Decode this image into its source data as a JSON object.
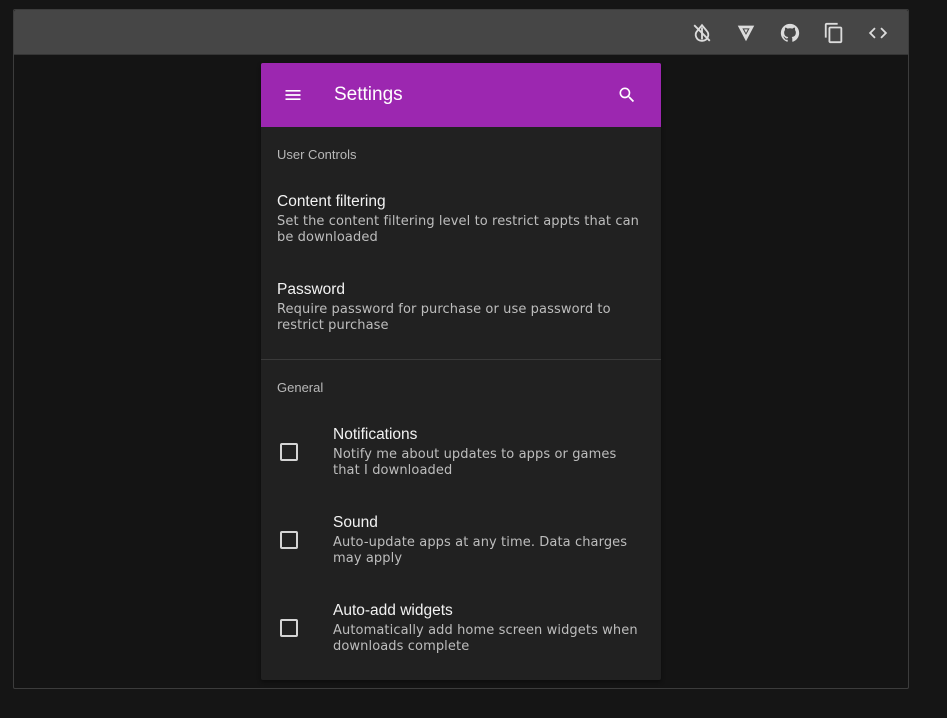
{
  "toolbar": {
    "icons": [
      "invert-colors-off-icon",
      "vuetify-logo-icon",
      "github-icon",
      "clipboard-icon",
      "code-icon"
    ]
  },
  "app_bar": {
    "title": "Settings",
    "color": "#9c27b0"
  },
  "user_controls": {
    "subheader": "User Controls",
    "items": [
      {
        "title": "Content filtering",
        "subtitle": "Set the content filtering level to restrict appts that can be downloaded"
      },
      {
        "title": "Password",
        "subtitle": "Require password for purchase or use password to restrict purchase"
      }
    ]
  },
  "general": {
    "subheader": "General",
    "items": [
      {
        "title": "Notifications",
        "subtitle": "Notify me about updates to apps or games that I downloaded",
        "checked": false
      },
      {
        "title": "Sound",
        "subtitle": "Auto-update apps at any time. Data charges may apply",
        "checked": false
      },
      {
        "title": "Auto-add widgets",
        "subtitle": "Automatically add home screen widgets when downloads complete",
        "checked": false
      }
    ]
  }
}
